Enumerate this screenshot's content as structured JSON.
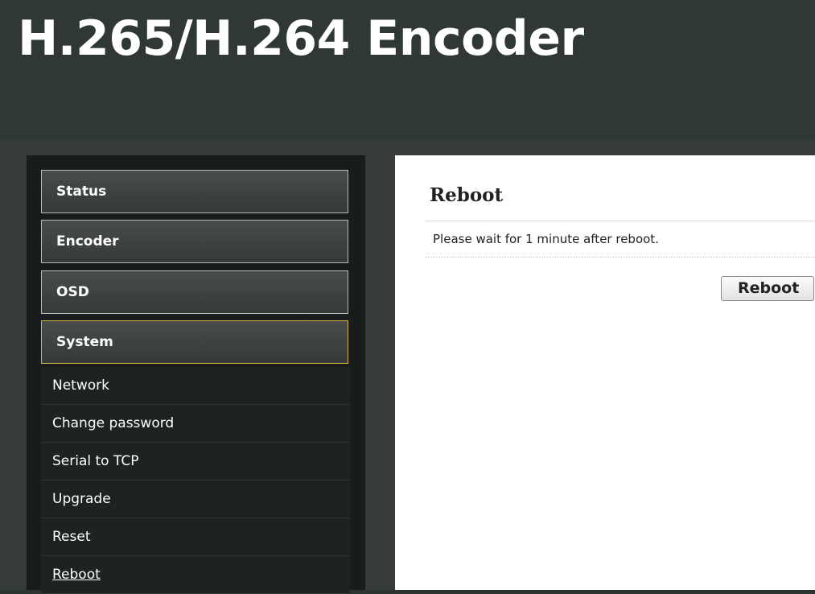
{
  "header": {
    "title": "H.265/H.264 Encoder"
  },
  "sidebar": {
    "menu": [
      {
        "label": "Status",
        "active": false
      },
      {
        "label": "Encoder",
        "active": false
      },
      {
        "label": "OSD",
        "active": false
      },
      {
        "label": "System",
        "active": true
      }
    ],
    "submenu": [
      {
        "label": "Network"
      },
      {
        "label": "Change password"
      },
      {
        "label": "Serial to TCP"
      },
      {
        "label": "Upgrade"
      },
      {
        "label": "Reset"
      },
      {
        "label": "Reboot",
        "current": true
      }
    ]
  },
  "main": {
    "title": "Reboot",
    "notice": "Please wait for 1 minute after reboot.",
    "reboot_button": "Reboot"
  },
  "colors": {
    "active_menu_border": "#d3b04a",
    "header_background": "#2f3835",
    "sidebar_background": "#181c1b"
  }
}
